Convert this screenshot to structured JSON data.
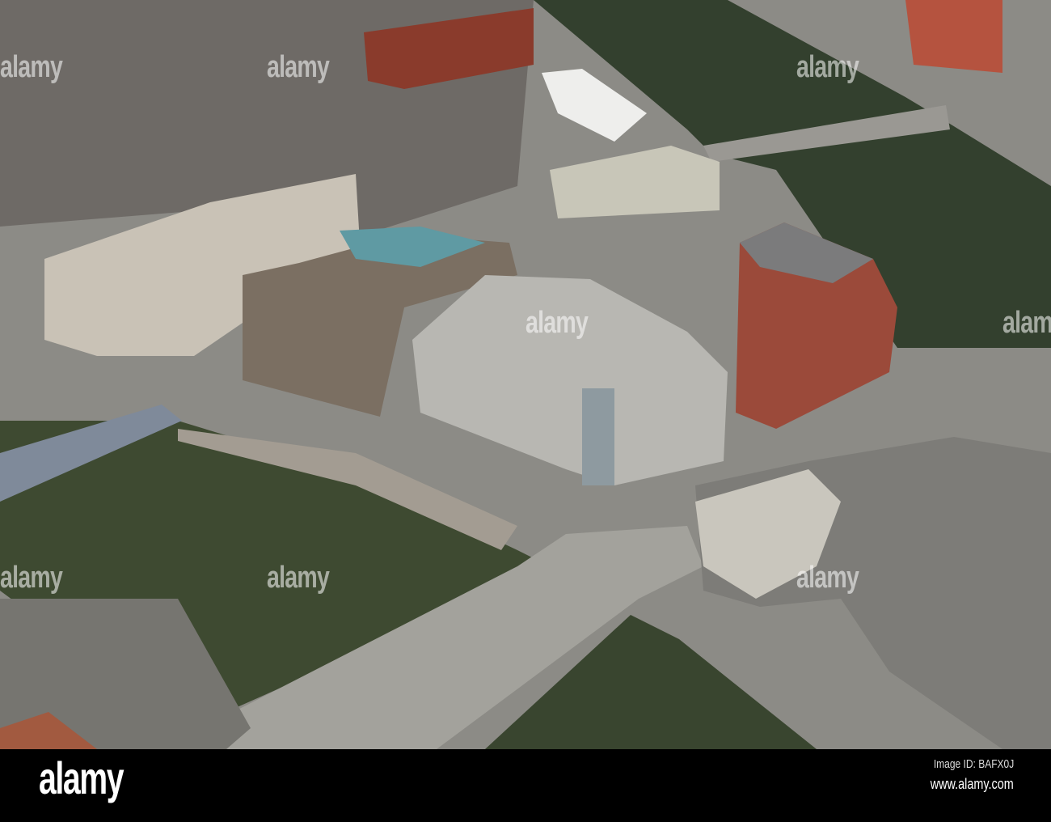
{
  "watermark": {
    "text": "alamy"
  },
  "footer": {
    "logo": "alamy",
    "image_id": "Image ID: BAFX0J",
    "website": "www.alamy.com"
  },
  "colors": {
    "water": "#3d4a2e",
    "land": "#8a8a86",
    "footer": "#000000"
  }
}
